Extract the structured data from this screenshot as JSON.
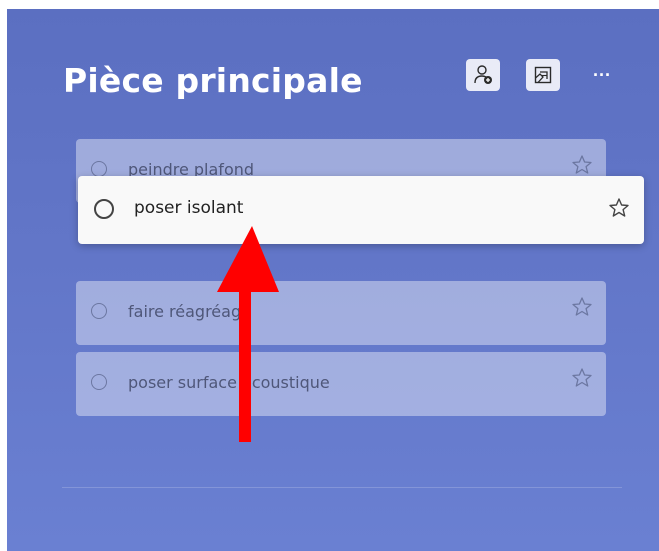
{
  "list": {
    "title": "Pièce principale",
    "header_buttons": [
      {
        "icon": "share-person-icon"
      },
      {
        "icon": "background-image-icon"
      },
      {
        "icon": "more-options-icon",
        "label": "···"
      }
    ]
  },
  "tasks": [
    {
      "label": "peindre plafond",
      "icon": "star-outline-icon"
    },
    {
      "label": "faire réagréage",
      "icon": "star-outline-icon"
    },
    {
      "label": "poser surface acoustique",
      "icon": "star-outline-icon"
    }
  ],
  "dragged_task": {
    "label": "poser isolant",
    "icon": "star-outline-icon"
  },
  "annotation": {
    "color": "#ff0000",
    "icon": "red-up-arrow"
  },
  "colors": {
    "accent": "#5b6fc1",
    "annotation": "#ff0000"
  }
}
